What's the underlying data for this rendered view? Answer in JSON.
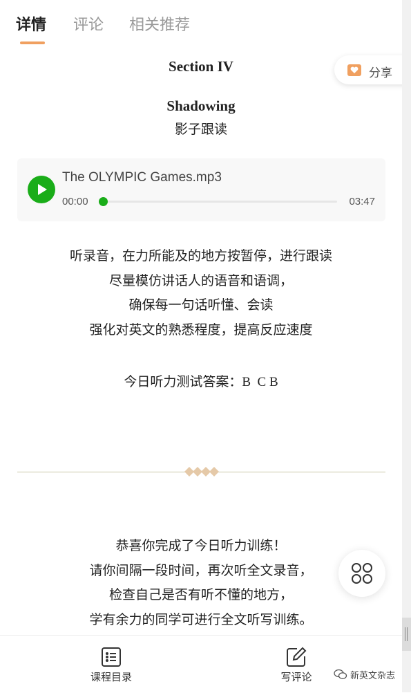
{
  "tabs": [
    {
      "label": "详情"
    },
    {
      "label": "评论"
    },
    {
      "label": "相关推荐"
    }
  ],
  "share": {
    "label": "分享",
    "icon": "share-heart-icon",
    "icon_color": "#f0a060"
  },
  "article": {
    "section_title": "Section IV",
    "shadowing_title": "Shadowing",
    "shadowing_subtitle": "影子跟读",
    "instructions": [
      "听录音，在力所能及的地方按暂停，进行跟读",
      "尽量模仿讲话人的语音和语调，",
      "确保每一句话听懂、会读",
      "强化对英文的熟悉程度，提高反应速度"
    ],
    "answer": "今日听力测试答案：B  C B",
    "closing": [
      "恭喜你完成了今日听力训练！",
      "请你间隔一段时间，再次听全文录音，",
      "检查自己是否有听不懂的地方，",
      "学有余力的同学可进行全文听写训练。"
    ]
  },
  "audio": {
    "title": "The OLYMPIC Games.mp3",
    "current_time": "00:00",
    "duration": "03:47",
    "progress": 0,
    "accent": "#1aad19"
  },
  "bottom_bar": {
    "catalog_label": "课程目录",
    "comment_label": "写评论"
  },
  "watermark": {
    "text": "新英文杂志"
  },
  "colors": {
    "tab_indicator": "#f0a060",
    "divider": "#c9c7a8"
  }
}
